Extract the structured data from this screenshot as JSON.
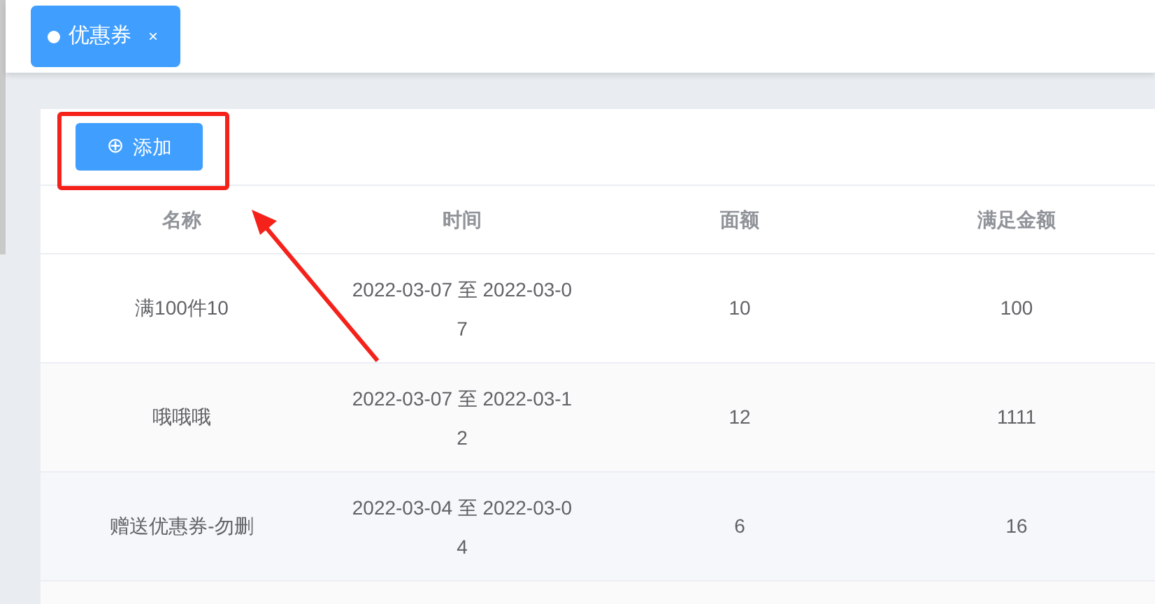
{
  "tabs": [
    {
      "label": "优惠券",
      "close": "×",
      "selected": true
    }
  ],
  "toolbar": {
    "add_button": {
      "icon": "⊕",
      "label": "添加"
    }
  },
  "table": {
    "columns": [
      "名称",
      "时间",
      "面额",
      "满足金额"
    ],
    "rows": [
      {
        "cells": [
          "满100件10",
          "2022-03-07 至 2022-03-07",
          "10",
          "100"
        ]
      },
      {
        "cells": [
          "哦哦哦",
          "2022-03-07 至 2022-03-12",
          "12",
          "1111"
        ]
      },
      {
        "cells": [
          "赠送优惠券-勿删",
          "2022-03-04 至 2022-03-04",
          "6",
          "16"
        ]
      }
    ]
  }
}
